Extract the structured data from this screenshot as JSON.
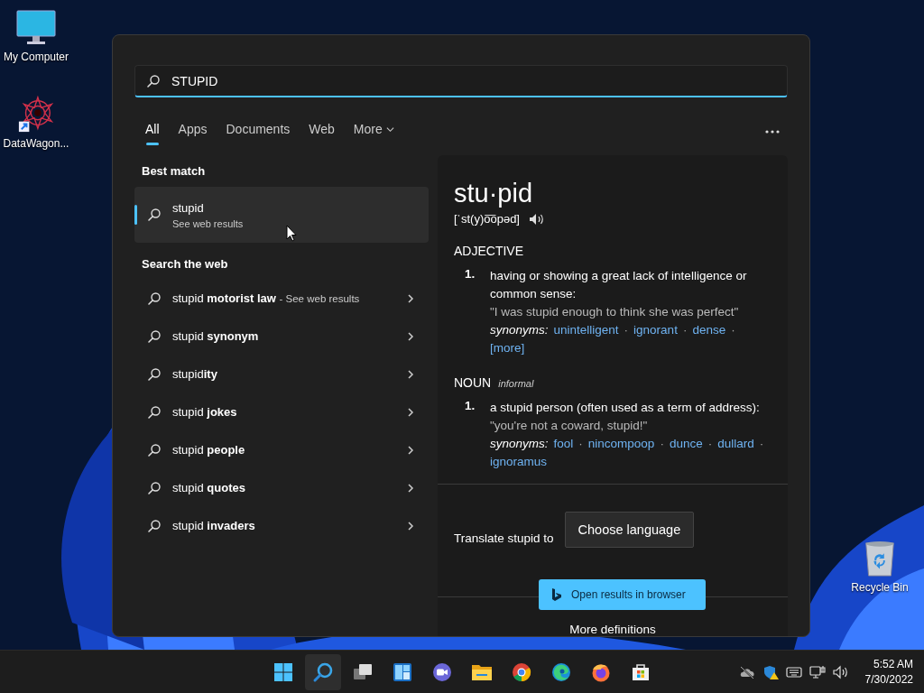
{
  "desktop_icons": [
    {
      "label": "My Computer",
      "kind": "computer"
    },
    {
      "label": "DataWagon...",
      "kind": "shortcut"
    },
    {
      "label": "Recycle Bin",
      "kind": "recycle"
    }
  ],
  "search": {
    "value": "STUPID"
  },
  "tabs": [
    {
      "label": "All",
      "selected": true
    },
    {
      "label": "Apps",
      "selected": false
    },
    {
      "label": "Documents",
      "selected": false
    },
    {
      "label": "Web",
      "selected": false
    },
    {
      "label": "More",
      "selected": false,
      "kind": "dropdown"
    }
  ],
  "best_match": {
    "heading": "Best match",
    "title": "stupid",
    "subtitle": "See web results",
    "selected": true
  },
  "web": {
    "heading": "Search the web",
    "items": [
      {
        "text": "stupid **motorist law**",
        "suffix": "- See web results"
      },
      {
        "text": "stupid **synonym**"
      },
      {
        "text": "stupid**ity**"
      },
      {
        "text": "stupid **jokes**"
      },
      {
        "text": "stupid **people**"
      },
      {
        "text": "stupid **quotes**"
      },
      {
        "text": "stupid **invaders**"
      }
    ]
  },
  "definition": {
    "word": "stu·pid",
    "pronunciation": "[ˈst(y)o͞opəd]",
    "separator": "·",
    "groups": [
      {
        "pos": "ADJECTIVE",
        "senses": [
          {
            "number": "1.",
            "text": "having or showing a great lack of intelligence or common sense:",
            "example": "\"I was stupid enough to think she was perfect\"",
            "synonyms_label": "synonyms:",
            "synonyms": [
              "unintelligent",
              "ignorant",
              "dense",
              "[more]"
            ]
          }
        ]
      },
      {
        "pos": "NOUN",
        "register": "informal",
        "senses": [
          {
            "number": "1.",
            "text": "a stupid person (often used as a term of address):",
            "example": "\"you're not a coward, stupid!\"",
            "synonyms_label": "synonyms:",
            "synonyms": [
              "fool",
              "nincompoop",
              "dunce",
              "dullard",
              "ignoramus"
            ]
          }
        ]
      }
    ]
  },
  "translate": {
    "label": "Translate stupid to",
    "button": "Choose language"
  },
  "more_definitions": "More definitions",
  "toast": "Open results in browser",
  "taskbar": {
    "apps": [
      {
        "kind": "start",
        "selected": false
      },
      {
        "kind": "search",
        "selected": true
      },
      {
        "kind": "taskview",
        "selected": false
      },
      {
        "kind": "widgets",
        "selected": false
      },
      {
        "kind": "chat",
        "selected": false
      },
      {
        "kind": "explorer",
        "selected": false
      },
      {
        "kind": "chrome",
        "selected": false
      },
      {
        "kind": "edge",
        "selected": false
      },
      {
        "kind": "firefox",
        "selected": false
      },
      {
        "kind": "store",
        "selected": false
      }
    ],
    "clock": {
      "time": "5:52 AM",
      "date": "7/30/2022"
    }
  }
}
